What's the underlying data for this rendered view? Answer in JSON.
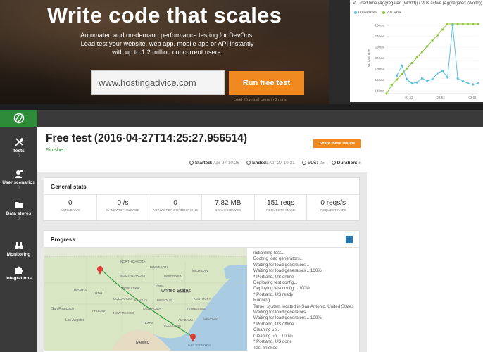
{
  "hero": {
    "title": "Write code that scales",
    "subtitle": "Automated and on-demand performance testing for DevOps. Load test your website, web app, mobile app or API instantly with up to 1.2 million concurrent users.",
    "input_value": "www.hostingadvice.com",
    "button_label": "Run free test",
    "note": "Load 25 virtual users in 5 mins"
  },
  "top_chart": {
    "title": "VU load time (Aggregated (World)) / VUs active (Aggregated (World))",
    "legend": [
      "VU load time",
      "VUs active"
    ],
    "colors": {
      "load": "#5bc0de",
      "active": "#8cc63f"
    },
    "y_ticks": [
      "260ms",
      "240ms",
      "220ms",
      "200ms",
      "180ms",
      "160ms",
      "140ms"
    ],
    "x_ticks": [
      "03:52",
      "03:53",
      "03:54"
    ],
    "ylabel": "VU load time"
  },
  "chart_data": {
    "type": "line",
    "title": "VU load time (Aggregated (World)) / VUs active (Aggregated (World))",
    "ylabel": "VU load time",
    "x": [
      0,
      1,
      2,
      3,
      4,
      5,
      6,
      7,
      8,
      9,
      10,
      11,
      12,
      13,
      14,
      15,
      16,
      17,
      18
    ],
    "series": [
      {
        "name": "VU load time",
        "values": [
          null,
          null,
          165,
          185,
          158,
          150,
          152,
          160,
          155,
          158,
          170,
          175,
          162,
          265,
          160,
          155,
          150,
          148,
          150
        ]
      },
      {
        "name": "VUs active",
        "values": [
          0,
          3,
          5,
          7,
          9,
          11,
          13,
          15,
          17,
          19,
          21,
          23,
          25,
          25,
          25,
          25,
          25,
          25,
          25
        ]
      }
    ],
    "y_ticks": [
      "260ms",
      "240ms",
      "220ms",
      "200ms",
      "180ms",
      "160ms",
      "140ms"
    ],
    "x_ticks": [
      "03:52",
      "03:53",
      "03:54"
    ]
  },
  "sidebar": {
    "items": [
      {
        "label": "Tests",
        "count": "0",
        "icon": "tools-icon"
      },
      {
        "label": "User scenarios",
        "count": "0",
        "icon": "user-scenario-icon"
      },
      {
        "label": "Data stores",
        "count": "0",
        "icon": "folder-icon"
      },
      {
        "label": "Monitoring",
        "count": "",
        "icon": "binoculars-icon"
      },
      {
        "label": "Integrations",
        "count": "",
        "icon": "puzzle-icon"
      }
    ]
  },
  "test": {
    "title": "Free test (2016-04-27T14:25:27.956514)",
    "status": "Finished",
    "share_label": "Share these results",
    "meta": {
      "started_label": "Started:",
      "started_value": "Apr 27 10:26",
      "ended_label": "Ended:",
      "ended_value": "Apr 27 10:31",
      "vus_label": "VUs:",
      "vus_value": "25",
      "duration_label": "Duration:",
      "duration_value": "5"
    }
  },
  "general_stats": {
    "title": "General stats",
    "items": [
      {
        "value": "0",
        "label": "ACTIVE VUS"
      },
      {
        "value": "0 /s",
        "label": "BANDWIDTH USAGE"
      },
      {
        "value": "0",
        "label": "ACTIVE TCP CONNECTIONS"
      },
      {
        "value": "7.82 MB",
        "label": "DATA RECEIVED"
      },
      {
        "value": "151 reqs",
        "label": "REQUESTS MADE"
      },
      {
        "value": "0 reqs/s",
        "label": "REQUEST RATE"
      }
    ]
  },
  "progress": {
    "title": "Progress",
    "collapse_label": "−",
    "log": [
      "Initializing test...",
      "Booting load generators...",
      "Waiting for load generators...",
      "Waiting for load generators... 100%",
      "* Portland, US online",
      "Deploying test config...",
      "Deploying test config... 100%",
      "* Portland, US ready",
      "Running",
      "Target system located in San Antonio, United States",
      "Waiting for load generators...",
      "Waiting for load generators... 100%",
      "* Portland, US offline",
      "Cleaning up...",
      "Cleaning up... 100%",
      "* Portland, US done",
      "Test finished"
    ],
    "map_labels": {
      "united_states": "United States",
      "mexico": "Mexico",
      "north_dakota": "NORTH DAKOTA",
      "south_dakota": "SOUTH DAKOTA",
      "minnesota": "MINNESOTA",
      "nevada": "NEVADA",
      "utah": "UTAH",
      "kansas": "KANSAS",
      "missouri": "MISSOURI",
      "texas": "TEXAS",
      "oklahoma": "OKLAHOMA",
      "san_francisco": "San Francisco",
      "los_angeles": "Los Angeles",
      "new_mexico": "NEW MEXICO",
      "arizona": "ARIZONA",
      "colorado": "COLORADO",
      "wisconsin": "WISCONSIN",
      "iowa": "IOWA",
      "illinois": "ILLINOIS",
      "nebraska": "NEBRASKA",
      "georgia": "GEORGIA",
      "kentucky": "KENTUCKY",
      "tennessee": "TENNESSEE",
      "alabama": "ALABAMA",
      "louisiana": "LOUISIANA",
      "michigan": "MICHIGAN",
      "gulf": "Gulf of Mexico"
    }
  }
}
